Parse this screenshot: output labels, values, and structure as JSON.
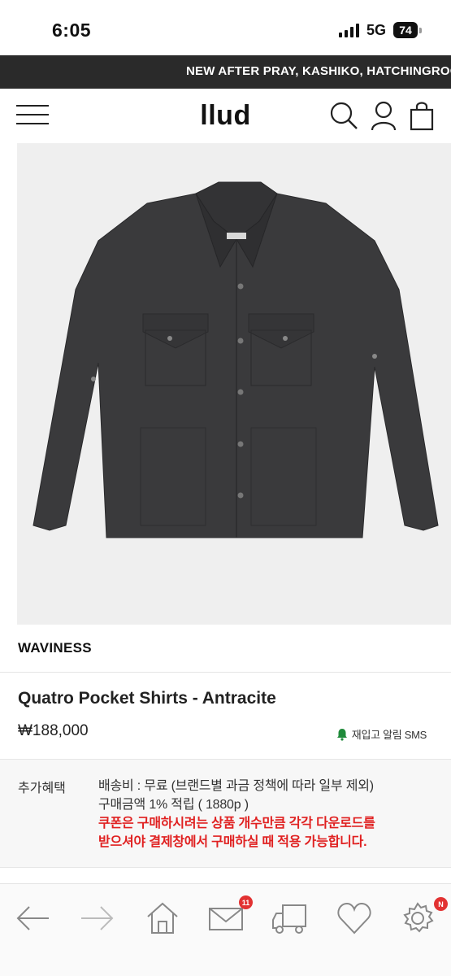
{
  "status": {
    "time": "6:05",
    "network": "5G",
    "battery": "74"
  },
  "banner": {
    "text": "NEW AFTER PRAY, KASHIKO, HATCHINGROOM"
  },
  "header": {
    "logo": "llud"
  },
  "product": {
    "brand": "WAVINESS",
    "name": "Quatro Pocket Shirts - Antracite",
    "price": "₩188,000",
    "restock_label": "재입고 알림 SMS"
  },
  "benefits": {
    "label": "추가혜택",
    "shipping": "배송비 : 무료 (브랜드별 과금 정책에 따라 일부 제외)",
    "points": "구매금액 1% 적립 ( 1880p )",
    "coupon_line1": "쿠폰은 구매하시려는 상품 개수만큼 각각 다운로드를",
    "coupon_line2": "받으셔야 결제창에서 구매하실 때 적용 가능합니다."
  },
  "bottom_nav": {
    "message_badge": "11",
    "settings_badge": "N",
    "icons": [
      "back-icon",
      "forward-icon",
      "home-icon",
      "mail-icon",
      "delivery-truck-icon",
      "heart-icon",
      "settings-icon"
    ]
  },
  "colors": {
    "banner_bg": "#2a2a2a",
    "coupon_red": "#e02020",
    "badge_red": "#e23232",
    "shirt": "#3a3a3c"
  }
}
